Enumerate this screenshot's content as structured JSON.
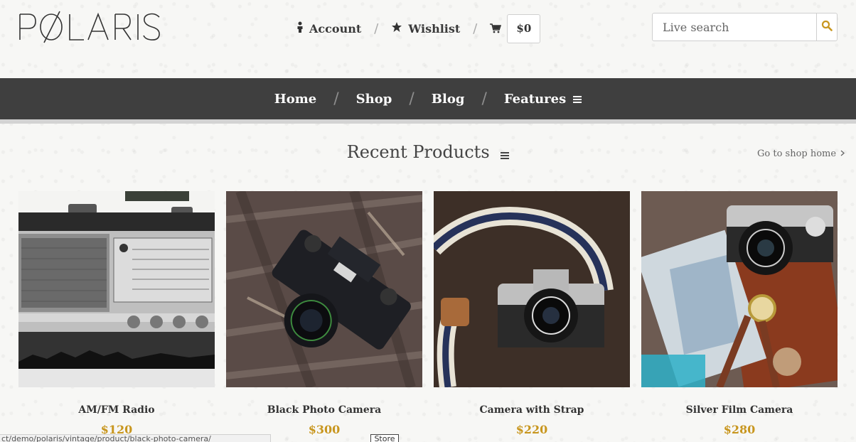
{
  "brand": {
    "logo_text": "POLARIS"
  },
  "header": {
    "account_label": "Account",
    "wishlist_label": "Wishlist",
    "cart_total": "$0"
  },
  "search": {
    "placeholder": "Live search"
  },
  "nav": {
    "items": [
      {
        "label": "Home"
      },
      {
        "label": "Shop"
      },
      {
        "label": "Blog"
      },
      {
        "label": "Features"
      }
    ]
  },
  "section": {
    "title": "Recent Products",
    "link_label": "Go to shop home"
  },
  "products": [
    {
      "name": "AM/FM Radio",
      "price": "$120"
    },
    {
      "name": "Black Photo Camera",
      "price": "$300"
    },
    {
      "name": "Camera with Strap",
      "price": "$220"
    },
    {
      "name": "Silver Film Camera",
      "price": "$280"
    }
  ],
  "status": {
    "url": "ct/demo/polaris/vintage/product/black-photo-camera/",
    "tooltip": "Store"
  },
  "colors": {
    "accent": "#c8961e",
    "nav_bg": "#3f3f3f"
  }
}
